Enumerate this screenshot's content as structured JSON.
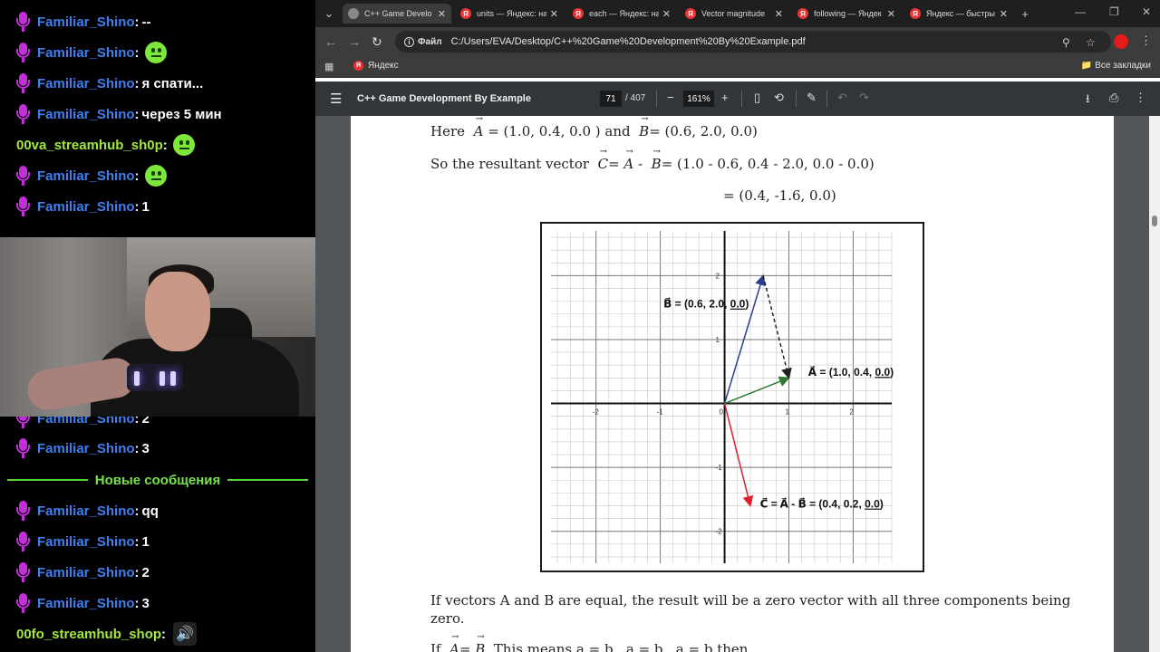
{
  "chat": {
    "messages": [
      {
        "nick": "Familiar_Shino",
        "text": "--",
        "badge": "mic",
        "emote": false
      },
      {
        "nick": "Familiar_Shino",
        "text": "",
        "badge": "mic",
        "emote": true
      },
      {
        "nick": "Familiar_Shino",
        "text": "я спати...",
        "badge": "mic",
        "emote": false
      },
      {
        "nick": "Familiar_Shino",
        "text": "через 5 мин",
        "badge": "mic",
        "emote": false
      },
      {
        "nick": "00va_streamhub_sh0p",
        "text": "",
        "badge": "none",
        "emote": true
      },
      {
        "nick": "Familiar_Shino",
        "text": "",
        "badge": "mic",
        "emote": true
      },
      {
        "nick": "Familiar_Shino",
        "text": "1",
        "badge": "mic",
        "emote": false
      },
      {
        "nick": "Familiar_Shino",
        "text": "2",
        "badge": "mic",
        "emote": false
      },
      {
        "nick": "Familiar_Shino",
        "text": "3",
        "badge": "mic",
        "emote": false
      },
      {
        "nick": "Familiar_Shino",
        "text": "qq",
        "badge": "mic",
        "emote": false
      },
      {
        "nick": "Familiar_Shino",
        "text": "1",
        "badge": "mic",
        "emote": false
      },
      {
        "nick": "Familiar_Shino",
        "text": "2",
        "badge": "mic",
        "emote": false
      },
      {
        "nick": "Familiar_Shino",
        "text": "3",
        "badge": "mic",
        "emote": false
      },
      {
        "nick": "00fo_streamhub_shop",
        "text": "",
        "badge": "none",
        "emote": false,
        "speaker": true
      }
    ],
    "new_messages_label": "Новые сообщения"
  },
  "browser": {
    "tabs": [
      {
        "title": "C++ Game Develo",
        "active": true,
        "icon": "pdf-globe-icon"
      },
      {
        "title": "units — Яндекс: на",
        "active": false,
        "icon": "yandex-icon"
      },
      {
        "title": "each — Яндекс: на",
        "active": false,
        "icon": "yandex-icon"
      },
      {
        "title": "Vector magnitude",
        "active": false,
        "icon": "yandex-icon"
      },
      {
        "title": "following — Яндек",
        "active": false,
        "icon": "yandex-icon"
      },
      {
        "title": "Яндекс — быстры",
        "active": false,
        "icon": "yandex-icon"
      }
    ],
    "address": {
      "chip": "Файл",
      "url": "C:/Users/EVA/Desktop/C++%20Game%20Development%20By%20Example.pdf"
    },
    "bookmarks": {
      "item": "Яндекс",
      "all_bookmarks": "Все закладки"
    },
    "pdf_toolbar": {
      "title": "C++ Game Development By Example",
      "page": "71",
      "total": "/ 407",
      "zoom": "161%"
    }
  },
  "page": {
    "line1": {
      "prefix": "Here",
      "A": "A",
      "a_value": "= (1.0, 0.4, 0.0 ) and",
      "B": "B",
      "b_value": "= (0.6, 2.0, 0.0)"
    },
    "line2": {
      "prefix": "So the resultant vector",
      "C": "C",
      "eq": "=",
      "A": "A",
      "minus": "-",
      "B": "B",
      "rest": "= (1.0 - 0.6, 0.4 - 2.0, 0.0 - 0.0)"
    },
    "line3": "= (0.4, -1.6, 0.0)",
    "para": "If vectors A and B are equal, the result will be a zero vector with all three components being",
    "para2": "zero.",
    "last_line": {
      "prefix": "If",
      "A": "A",
      "eq": "=",
      "B": "B",
      "rest": ". This means a   = b  , a   = b  , a   = b   then"
    }
  },
  "chart_data": {
    "type": "scatter",
    "xlim": [
      -2.7,
      2.6
    ],
    "ylim": [
      -2.5,
      2.7
    ],
    "grid": true,
    "x_ticks": [
      -2,
      -1,
      0,
      1,
      2
    ],
    "y_ticks": [
      -2,
      -1,
      1,
      2
    ],
    "x_tick_labels": [
      "-2",
      "-1",
      "0",
      "1",
      "2"
    ],
    "y_tick_labels": [
      "-2",
      "-1",
      "1",
      "2"
    ],
    "vectors": [
      {
        "label_vec": "B",
        "label_rest": " = (0.6, 2.0, ",
        "label_z": "0.0",
        "label_close": ")",
        "from": [
          0,
          0
        ],
        "to": [
          0.6,
          2.0
        ],
        "color": "#2c3d8f",
        "dashed": false
      },
      {
        "label_vec": "A",
        "label_rest": " = (1.0, 0.4, ",
        "label_z": "0.0",
        "label_close": ")",
        "from": [
          0,
          0
        ],
        "to": [
          1.0,
          0.4
        ],
        "color": "#2f7a2f",
        "dashed": false
      },
      {
        "label_vec": "",
        "label_rest": "",
        "label_z": "",
        "label_close": "",
        "from": [
          0.6,
          2.0
        ],
        "to": [
          1.0,
          0.4
        ],
        "color": "#222222",
        "dashed": true
      },
      {
        "label_vec": "C",
        "label_rest": " = (0.4, 0.2, ",
        "label_z": "0.0",
        "label_close": ")",
        "label_expr": [
          "C",
          " = ",
          "A",
          " - ",
          "B"
        ],
        "from": [
          0,
          0
        ],
        "to": [
          0.4,
          -1.6
        ],
        "color": "#e0202e",
        "dashed": false
      }
    ]
  }
}
